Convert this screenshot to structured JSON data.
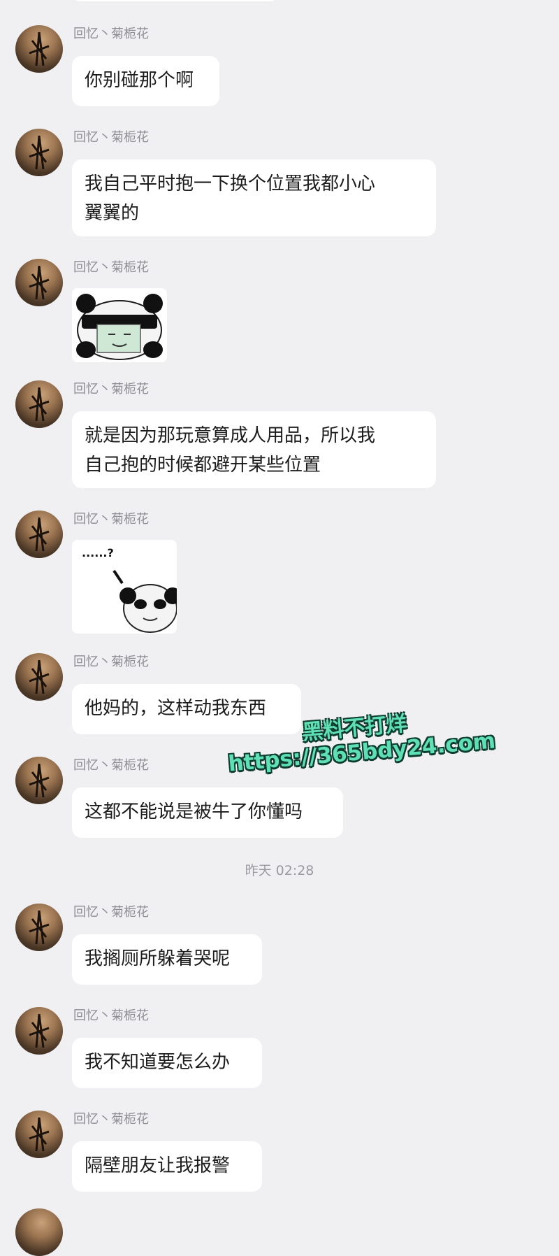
{
  "sender_name": "回忆丶菊栀花",
  "messages": [
    {
      "type": "text",
      "text": "你别碰那个啊"
    },
    {
      "type": "text",
      "text": "我自己平时抱一下换个位置我都小心翼翼的"
    },
    {
      "type": "sticker",
      "sticker": "panda-meme-sticker-mask"
    },
    {
      "type": "text",
      "text": "就是因为那玩意算成人用品，所以我自己抱的时候都避开某些位置"
    },
    {
      "type": "sticker",
      "sticker": "panda-meme-sticker-question",
      "caption": "......?"
    },
    {
      "type": "text",
      "text": "他妈的，这样动我东西"
    },
    {
      "type": "text",
      "text": "这都不能说是被牛了你懂吗"
    },
    {
      "type": "text",
      "text": "我搁厕所躲着哭呢"
    },
    {
      "type": "text",
      "text": "我不知道要怎么办"
    },
    {
      "type": "text",
      "text": "隔壁朋友让我报警"
    }
  ],
  "timestamp": "昨天 02:28",
  "watermark": {
    "line1": "黑料不打烊",
    "line2": "https://365bdy24.com"
  },
  "text_lines": {
    "m2_l1": "我自己平时抱一下换个位置我都小心",
    "m2_l2": "翼翼的",
    "m4_l1": "就是因为那玩意算成人用品，所以我",
    "m4_l2": "自己抱的时候都避开某些位置"
  },
  "colors": {
    "background": "#f0f0f3",
    "bubble": "#ffffff",
    "watermark": "#5fe0b4"
  }
}
